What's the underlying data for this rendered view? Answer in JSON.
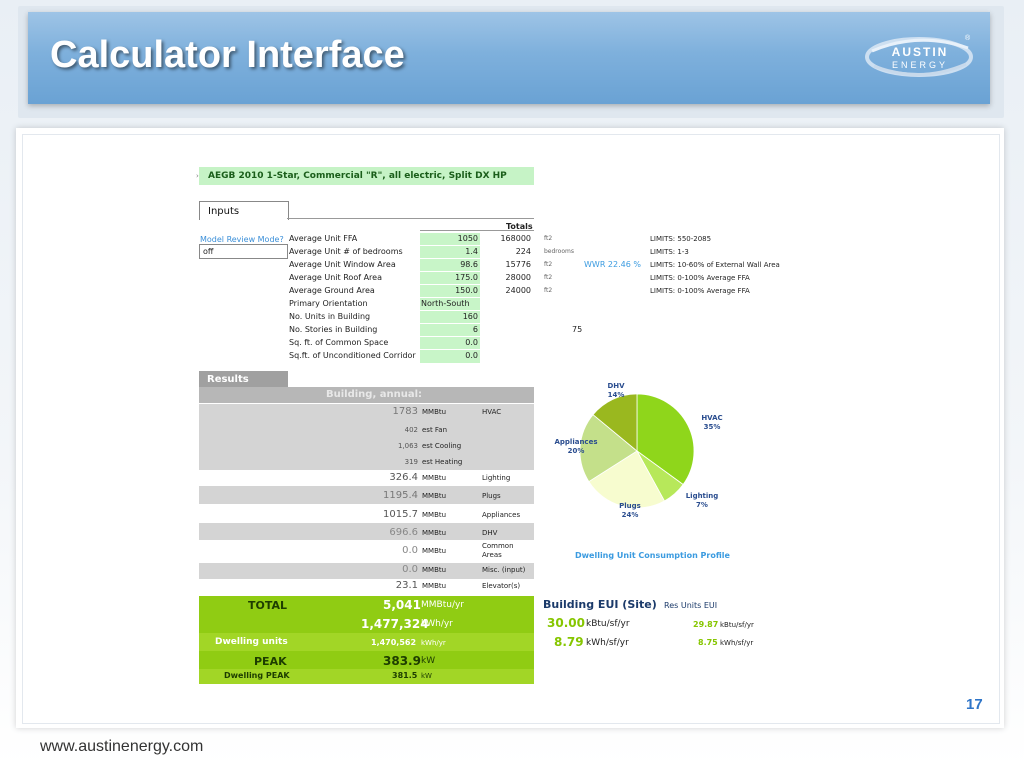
{
  "slide": {
    "title": "Calculator Interface",
    "page_number": "17",
    "footer_url": "www.austinenergy.com",
    "logo_text_top": "AUSTIN",
    "logo_text_bottom": "ENERGY",
    "logo_mark": "®"
  },
  "calculator": {
    "header": "AEGB 2010 1-Star, Commercial \"R\", all electric, Split DX HP",
    "inputs_tab": "Inputs",
    "totals_header": "Totals",
    "model_review_label": "Model Review Mode?",
    "model_review_value": "off",
    "input_rows": [
      {
        "label": "Average Unit FFA",
        "value": "1050",
        "total": "168000",
        "unit": "ft2",
        "extra": "",
        "limits": "LIMITS: 550-2085"
      },
      {
        "label": "Average Unit # of bedrooms",
        "value": "1.4",
        "total": "224",
        "unit": "bedrooms",
        "extra": "",
        "limits": "LIMITS: 1-3"
      },
      {
        "label": "Average Unit Window Area",
        "value": "98.6",
        "total": "15776",
        "unit": "ft2",
        "extra": "WWR 22.46 %",
        "limits": "LIMITS: 10-60% of External Wall Area"
      },
      {
        "label": "Average Unit Roof Area",
        "value": "175.0",
        "total": "28000",
        "unit": "ft2",
        "extra": "",
        "limits": "LIMITS: 0-100% Average FFA"
      },
      {
        "label": "Average Ground Area",
        "value": "150.0",
        "total": "24000",
        "unit": "ft2",
        "extra": "",
        "limits": "LIMITS: 0-100% Average FFA"
      },
      {
        "label": "Primary Orientation",
        "value": "North-South",
        "total": "",
        "unit": "",
        "extra": "",
        "limits": ""
      },
      {
        "label": "No. Units in Building",
        "value": "160",
        "total": "",
        "unit": "",
        "extra": "",
        "limits": ""
      },
      {
        "label": "No. Stories in Building",
        "value": "6",
        "total": "",
        "unit": "",
        "extra": "75",
        "limits": ""
      },
      {
        "label": "Sq. ft. of Common Space",
        "value": "0.0",
        "total": "",
        "unit": "",
        "extra": "",
        "limits": ""
      },
      {
        "label": "Sq.ft. of Unconditioned Corridor",
        "value": "0.0",
        "total": "",
        "unit": "",
        "extra": "",
        "limits": ""
      }
    ],
    "results_tab": "Results",
    "results_header": "Building, annual:",
    "result_rows": [
      {
        "value": "1783",
        "unit": "MMBtu",
        "label": "HVAC"
      },
      {
        "value": "402",
        "unit": "est Fan",
        "label": ""
      },
      {
        "value": "1,063",
        "unit": "est Cooling",
        "label": ""
      },
      {
        "value": "319",
        "unit": "est Heating",
        "label": ""
      },
      {
        "value": "326.4",
        "unit": "MMBtu",
        "label": "Lighting"
      },
      {
        "value": "1195.4",
        "unit": "MMBtu",
        "label": "Plugs"
      },
      {
        "value": "1015.7",
        "unit": "MMBtu",
        "label": "Appliances"
      },
      {
        "value": "696.6",
        "unit": "MMBtu",
        "label": "DHV"
      },
      {
        "value": "0.0",
        "unit": "MMBtu",
        "label": "Common Areas"
      },
      {
        "value": "0.0",
        "unit": "MMBtu",
        "label": "Misc. (input)"
      },
      {
        "value": "23.1",
        "unit": "MMBtu",
        "label": "Elevator(s)"
      }
    ],
    "totals": {
      "total_label": "TOTAL",
      "total_mmbtu": "5,041",
      "total_mmbtu_unit": "MMBtu/yr",
      "total_kwh": "1,477,324",
      "total_kwh_unit": "kWh/yr",
      "dwelling_label": "Dwelling units",
      "dwelling_kwh": "1,470,562",
      "dwelling_kwh_unit": "kWh/yr",
      "peak_label": "PEAK",
      "peak_value": "383.9",
      "peak_unit": "kW",
      "dwelling_peak_label": "Dwelling PEAK",
      "dwelling_peak_value": "381.5",
      "dwelling_peak_unit": "kW"
    },
    "eui": {
      "building_label": "Building EUI (Site)",
      "res_label": "Res Units EUI",
      "kbtu_value": "30.00",
      "kbtu_unit": "kBtu/sf/yr",
      "kwh_value": "8.79",
      "kwh_unit": "kWh/sf/yr",
      "res_kbtu_value": "29.87",
      "res_kbtu_unit": "kBtu/sf/yr",
      "res_kwh_value": "8.75",
      "res_kwh_unit": "kWh/sf/yr"
    }
  },
  "chart_data": {
    "type": "pie",
    "title": "Dwelling Unit Consumption Profile",
    "categories": [
      "HVAC",
      "Lighting",
      "Plugs",
      "Appliances",
      "DHV"
    ],
    "values": [
      35,
      7,
      24,
      20,
      14
    ],
    "labels": [
      "HVAC\n35%",
      "Lighting\n7%",
      "Plugs\n24%",
      "Appliances\n20%",
      "DHV\n14%"
    ],
    "colors": [
      "#8fd61b",
      "#b7e85a",
      "#f7fccf",
      "#c4e08a",
      "#9ab81f"
    ]
  }
}
